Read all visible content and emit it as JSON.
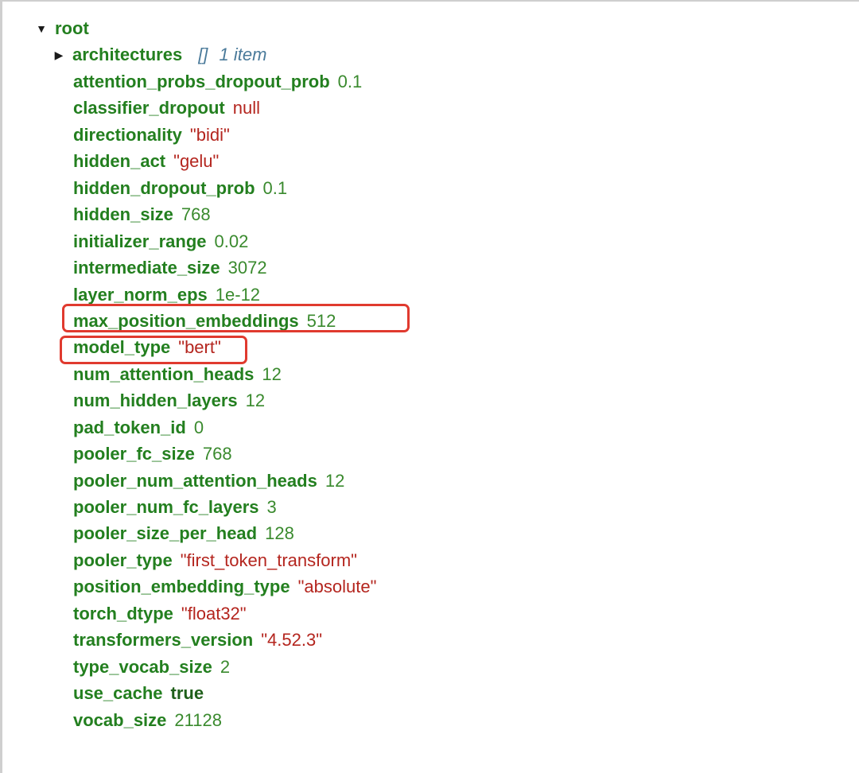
{
  "root": {
    "toggle_symbol": "▼",
    "label": "root"
  },
  "architectures": {
    "toggle_symbol": "▶",
    "key": "architectures",
    "bracket": "[]",
    "count": "1 item"
  },
  "properties": [
    {
      "key": "attention_probs_dropout_prob",
      "value": "0.1",
      "type": "number"
    },
    {
      "key": "classifier_dropout",
      "value": "null",
      "type": "null"
    },
    {
      "key": "directionality",
      "value": "\"bidi\"",
      "type": "string"
    },
    {
      "key": "hidden_act",
      "value": "\"gelu\"",
      "type": "string"
    },
    {
      "key": "hidden_dropout_prob",
      "value": "0.1",
      "type": "number"
    },
    {
      "key": "hidden_size",
      "value": "768",
      "type": "number"
    },
    {
      "key": "initializer_range",
      "value": "0.02",
      "type": "number"
    },
    {
      "key": "intermediate_size",
      "value": "3072",
      "type": "number"
    },
    {
      "key": "layer_norm_eps",
      "value": "1e-12",
      "type": "number"
    },
    {
      "key": "max_position_embeddings",
      "value": "512",
      "type": "number"
    },
    {
      "key": "model_type",
      "value": "\"bert\"",
      "type": "string"
    },
    {
      "key": "num_attention_heads",
      "value": "12",
      "type": "number"
    },
    {
      "key": "num_hidden_layers",
      "value": "12",
      "type": "number"
    },
    {
      "key": "pad_token_id",
      "value": "0",
      "type": "number"
    },
    {
      "key": "pooler_fc_size",
      "value": "768",
      "type": "number"
    },
    {
      "key": "pooler_num_attention_heads",
      "value": "12",
      "type": "number"
    },
    {
      "key": "pooler_num_fc_layers",
      "value": "3",
      "type": "number"
    },
    {
      "key": "pooler_size_per_head",
      "value": "128",
      "type": "number"
    },
    {
      "key": "pooler_type",
      "value": "\"first_token_transform\"",
      "type": "string"
    },
    {
      "key": "position_embedding_type",
      "value": "\"absolute\"",
      "type": "string"
    },
    {
      "key": "torch_dtype",
      "value": "\"float32\"",
      "type": "string"
    },
    {
      "key": "transformers_version",
      "value": "\"4.52.3\"",
      "type": "string"
    },
    {
      "key": "type_vocab_size",
      "value": "2",
      "type": "number"
    },
    {
      "key": "use_cache",
      "value": "true",
      "type": "bool"
    },
    {
      "key": "vocab_size",
      "value": "21128",
      "type": "number"
    }
  ],
  "highlighted_keys": [
    "max_position_embeddings",
    "model_type"
  ],
  "colors": {
    "key": "#237f1f",
    "number": "#3a8a2e",
    "string": "#b4251e",
    "null": "#b4251e",
    "meta": "#4a7a9a",
    "highlight": "#e03a2f"
  }
}
